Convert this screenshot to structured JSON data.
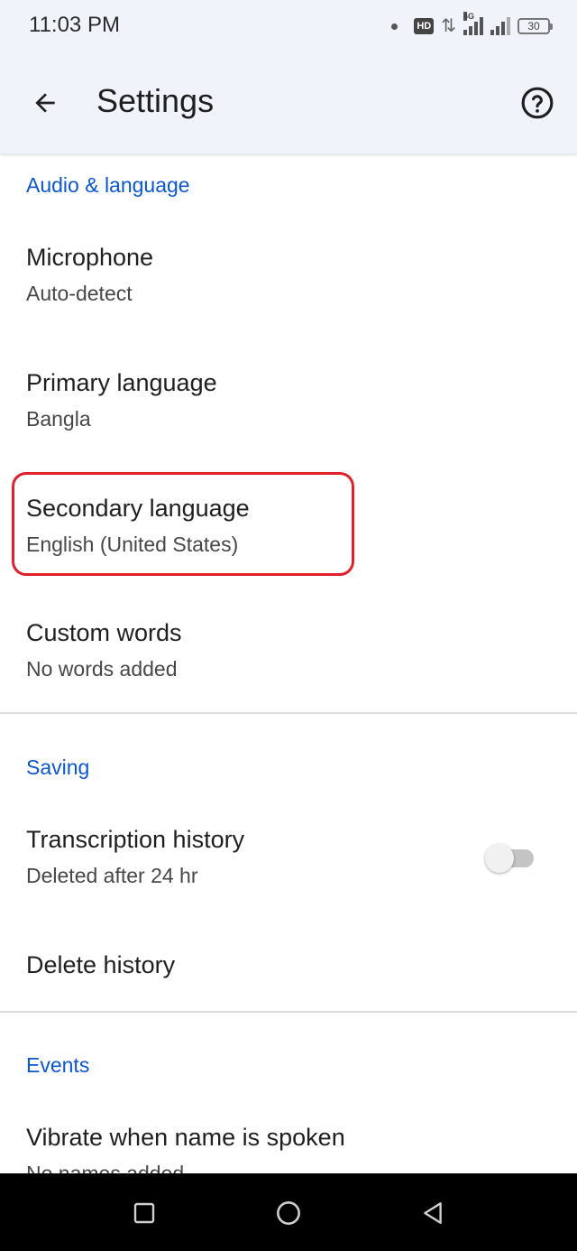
{
  "status_bar": {
    "time": "11:03 PM",
    "network_label": "4G",
    "hd_label": "HD",
    "battery": "30"
  },
  "app_bar": {
    "title": "Settings"
  },
  "sections": [
    {
      "header": "Audio & language",
      "items": [
        {
          "title": "Microphone",
          "subtitle": "Auto-detect"
        },
        {
          "title": "Primary language",
          "subtitle": "Bangla"
        },
        {
          "title": "Secondary language",
          "subtitle": "English (United States)"
        },
        {
          "title": "Custom words",
          "subtitle": "No words added"
        }
      ]
    },
    {
      "header": "Saving",
      "items": [
        {
          "title": "Transcription history",
          "subtitle": "Deleted after 24 hr",
          "toggle": false
        },
        {
          "title": "Delete history"
        }
      ]
    },
    {
      "header": "Events",
      "items": [
        {
          "title": "Vibrate when name is spoken",
          "subtitle": "No names added"
        }
      ]
    }
  ],
  "colors": {
    "accent": "#0b57d0",
    "highlight": "#e0202a",
    "app_bar_bg": "#f0f4fa"
  },
  "icons": {
    "back": "arrow-back-icon",
    "help": "help-circle-icon",
    "nav_recents": "square-icon",
    "nav_home": "circle-icon",
    "nav_back": "triangle-back-icon"
  }
}
